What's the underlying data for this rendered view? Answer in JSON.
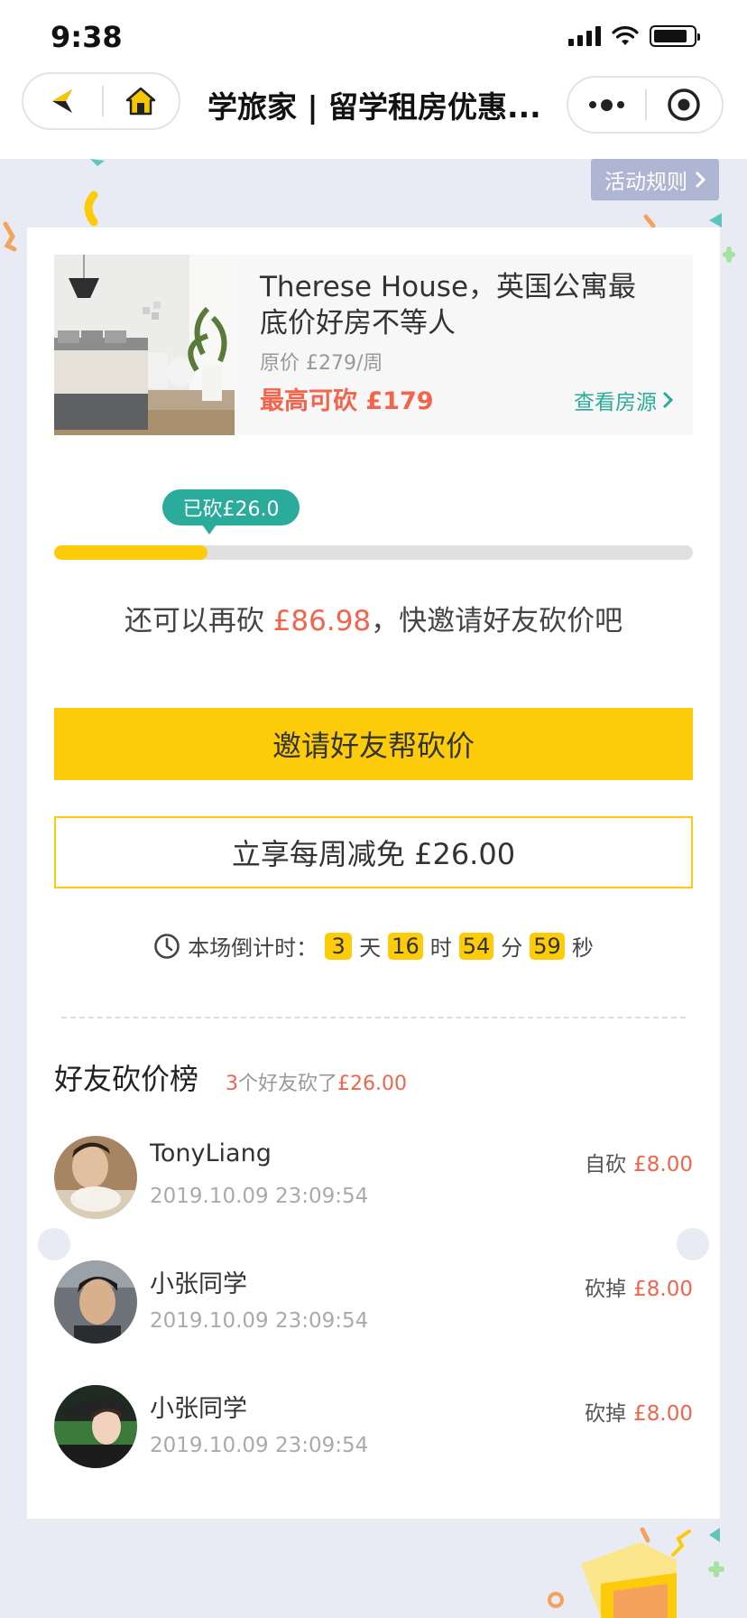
{
  "status_bar": {
    "time": "9:38"
  },
  "nav": {
    "title": "学旅家 | 留学租房优惠..."
  },
  "rules_label": "活动规则",
  "house": {
    "title": "Therese House，英国公寓最底价好房不等人",
    "original_price": "原价 £279/周",
    "max_cut": "最高可砍 £179",
    "view_label": "查看房源"
  },
  "progress": {
    "tip": "已砍£26.0",
    "fraction": 0.24
  },
  "remain": {
    "prefix": "还可以再砍 ",
    "amount": "£86.98",
    "suffix": "，快邀请好友砍价吧"
  },
  "invite_label": "邀请好友帮砍价",
  "discount_label": "立享每周减免 £26.00",
  "countdown": {
    "label": "本场倒计时：",
    "days": "3",
    "days_unit": "天",
    "hours": "16",
    "hours_unit": "时",
    "minutes": "54",
    "minutes_unit": "分",
    "seconds": "59",
    "seconds_unit": "秒"
  },
  "rank": {
    "title": "好友砍价榜",
    "count": "3",
    "sub_mid": "个好友砍了",
    "total": "£26.00",
    "friends": [
      {
        "name": "TonyLiang",
        "time": "2019.10.09 23:09:54",
        "action": "自砍",
        "amount": "£8.00"
      },
      {
        "name": "小张同学",
        "time": "2019.10.09 23:09:54",
        "action": "砍掉",
        "amount": "£8.00"
      },
      {
        "name": "小张同学",
        "time": "2019.10.09 23:09:54",
        "action": "砍掉",
        "amount": "£8.00"
      }
    ]
  },
  "colors": {
    "accent": "#fccc0a",
    "teal": "#2aab9b",
    "red": "#f2644c",
    "rules_bg": "#aeb6d3"
  }
}
